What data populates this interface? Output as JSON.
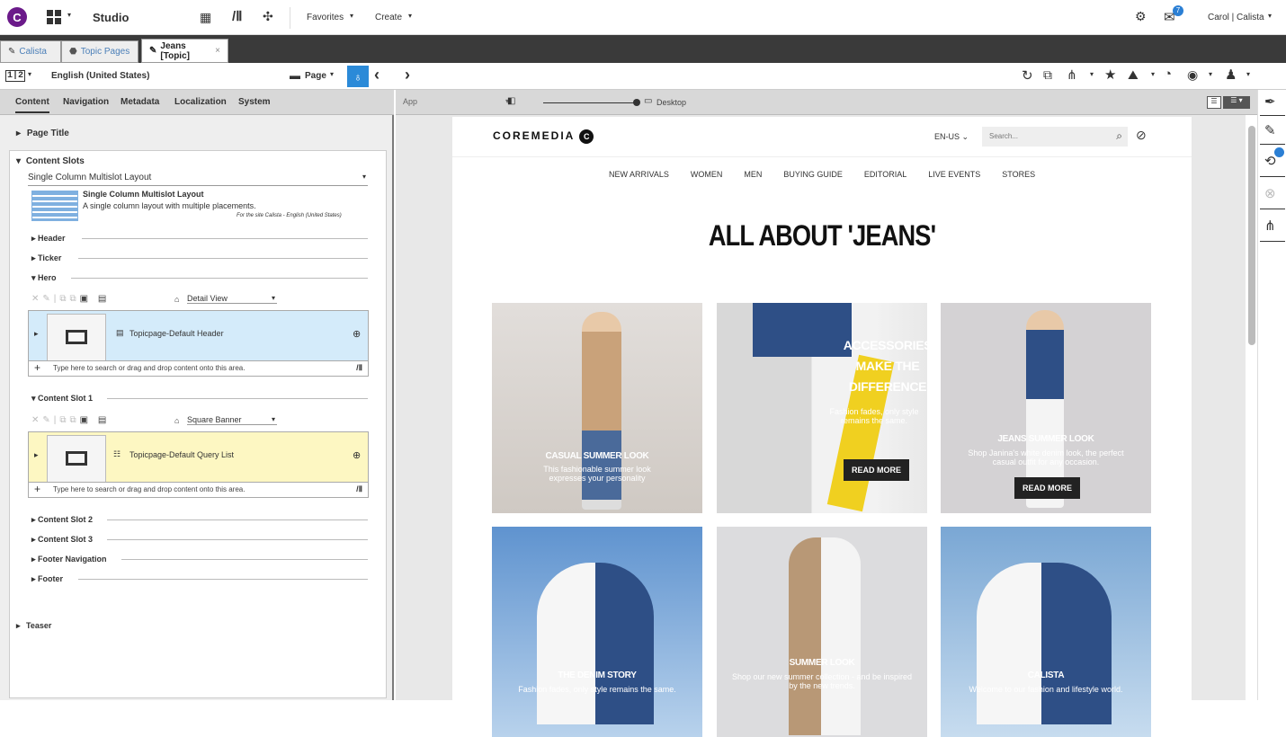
{
  "topbar": {
    "app_title": "Studio",
    "favorites": "Favorites",
    "create": "Create",
    "user": "Carol | Calista",
    "notifications": "7"
  },
  "tabs": [
    {
      "label": "Calista"
    },
    {
      "label": "Topic Pages"
    },
    {
      "label": "Jeans [Topic]"
    }
  ],
  "toolbar2": {
    "view": "1|2",
    "language": "English (United States)",
    "page": "Page"
  },
  "left": {
    "tabs": [
      "Content",
      "Navigation",
      "Metadata",
      "Localization",
      "System"
    ],
    "page_title": "Page Title",
    "content_slots": "Content Slots",
    "layout_select": "Single Column Multislot Layout",
    "layout_name": "Single Column Multislot Layout",
    "layout_desc": "A single column layout with multiple placements.",
    "layout_site": "For the site  Calista - English (United States)",
    "header": "Header",
    "ticker": "Ticker",
    "hero": "Hero",
    "hero_view": "Detail View",
    "hero_item": "Topicpage-Default Header",
    "placeholder": "Type here to search or drag and drop content onto this area.",
    "slot1": "Content Slot 1",
    "slot1_view": "Square Banner",
    "slot1_item": "Topicpage-Default Query List",
    "slot2": "Content Slot 2",
    "slot3": "Content Slot 3",
    "footer_nav": "Footer Navigation",
    "footer": "Footer",
    "teaser": "Teaser"
  },
  "preview": {
    "app": "App",
    "device": "Desktop"
  },
  "site": {
    "logo": "COREMEDIA",
    "lang": "EN-US",
    "search": "Search...",
    "nav": [
      "NEW ARRIVALS",
      "WOMEN",
      "MEN",
      "BUYING GUIDE",
      "EDITORIAL",
      "LIVE EVENTS",
      "STORES"
    ],
    "heading": "ALL ABOUT 'JEANS'",
    "cards": [
      {
        "title": "CASUAL SUMMER LOOK",
        "text": "This fashionable summer look expresses your personality",
        "color": "#d9d4cf"
      },
      {
        "title": "ACCESSORIES MAKE THE DIFFERENCE",
        "text": "Fashion fades, only style remains the same.",
        "button": "READ MORE",
        "color": "#bcbcbc"
      },
      {
        "title": "JEANS SUMMER LOOK",
        "text": "Shop Janina's white denim look, the perfect casual outfit for any occasion.",
        "button": "READ MORE",
        "color": "#d4d2d4"
      },
      {
        "title": "THE DENIM STORY",
        "text": "Fashion fades, only style remains the same.",
        "color": "#7aa7d4"
      },
      {
        "title": "SUMMER LOOK",
        "text": "Shop our new summer collection - and be inspired by the new trends.",
        "color": "#dcdcde"
      },
      {
        "title": "CALISTA",
        "text": "Welcome to our fashion and lifestyle world.",
        "color": "#8cb4dc"
      }
    ]
  }
}
